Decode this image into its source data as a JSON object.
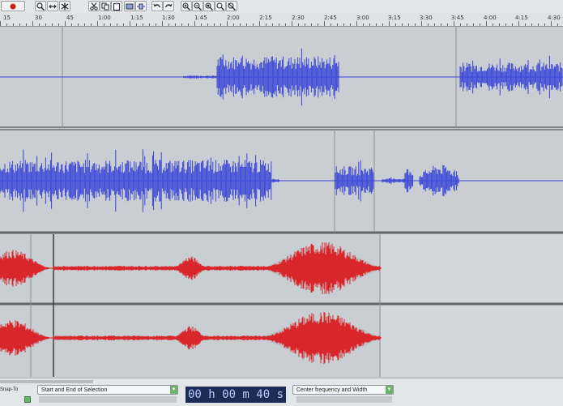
{
  "ruler": {
    "labels": [
      "15",
      "30",
      "45",
      "1:00",
      "1:15",
      "1:30",
      "1:45",
      "2:00",
      "2:15",
      "2:30",
      "2:45",
      "3:00",
      "3:15",
      "3:30",
      "3:45",
      "4:00",
      "4:15",
      "4:30"
    ]
  },
  "bottom": {
    "snap_label": "Snap-To",
    "selection_mode": "Start and End of Selection",
    "time_display": "00 h 00 m 40 s",
    "spectral_mode": "Center frequency and Width"
  },
  "colors": {
    "blue_wave": "#3a45d8",
    "red_wave": "#d8262b",
    "envelope": "#bfc2c6",
    "track_bg": "#c8cdd2",
    "time_bg": "#1d2b57"
  },
  "toolbar": {
    "icons": [
      "record-icon",
      "search-icon",
      "zoom-arrows-icon",
      "multi-tool-icon",
      "cut-icon",
      "copy-icon",
      "paste-icon",
      "trim-icon",
      "silence-icon",
      "undo-icon",
      "redo-icon",
      "zoom-in-icon",
      "zoom-out-icon",
      "zoom-selection-icon",
      "zoom-fit-icon",
      "zoom-toggle-icon"
    ]
  }
}
